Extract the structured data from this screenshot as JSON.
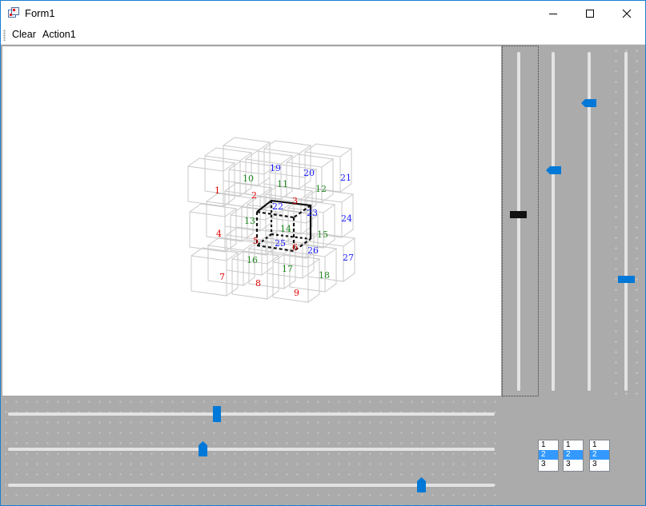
{
  "window": {
    "title": "Form1"
  },
  "menu": {
    "items": [
      {
        "label": "Clear"
      },
      {
        "label": "Action1"
      }
    ]
  },
  "scene": {
    "cube_numbers": [
      {
        "n": "1",
        "c": "red"
      },
      {
        "n": "2",
        "c": "red"
      },
      {
        "n": "3",
        "c": "red"
      },
      {
        "n": "4",
        "c": "red"
      },
      {
        "n": "5",
        "c": "red"
      },
      {
        "n": "6",
        "c": "red"
      },
      {
        "n": "7",
        "c": "red"
      },
      {
        "n": "8",
        "c": "red"
      },
      {
        "n": "9",
        "c": "red"
      },
      {
        "n": "10",
        "c": "green"
      },
      {
        "n": "11",
        "c": "green"
      },
      {
        "n": "12",
        "c": "green"
      },
      {
        "n": "13",
        "c": "green"
      },
      {
        "n": "14",
        "c": "green"
      },
      {
        "n": "15",
        "c": "green"
      },
      {
        "n": "16",
        "c": "green"
      },
      {
        "n": "17",
        "c": "green"
      },
      {
        "n": "18",
        "c": "green"
      },
      {
        "n": "19",
        "c": "blue"
      },
      {
        "n": "20",
        "c": "blue"
      },
      {
        "n": "21",
        "c": "blue"
      },
      {
        "n": "22",
        "c": "blue"
      },
      {
        "n": "23",
        "c": "blue"
      },
      {
        "n": "24",
        "c": "blue"
      },
      {
        "n": "25",
        "c": "blue"
      },
      {
        "n": "26",
        "c": "blue"
      },
      {
        "n": "27",
        "c": "blue"
      }
    ]
  },
  "sliders": {
    "vertical": [
      {
        "value": 0.48
      },
      {
        "value": 0.35
      },
      {
        "value": 0.15
      },
      {
        "value": 0.67
      }
    ],
    "horizontal": [
      {
        "value": 0.43
      },
      {
        "value": 0.4
      },
      {
        "value": 0.85
      }
    ]
  },
  "listboxes": [
    {
      "items": [
        "1",
        "2",
        "3"
      ],
      "selected": "2"
    },
    {
      "items": [
        "1",
        "2",
        "3"
      ],
      "selected": "2"
    },
    {
      "items": [
        "1",
        "2",
        "3"
      ],
      "selected": "2"
    }
  ],
  "colors": {
    "accent": "#0078d7",
    "red": "#e00000",
    "green": "#228b22",
    "blue": "#1a1aff"
  }
}
